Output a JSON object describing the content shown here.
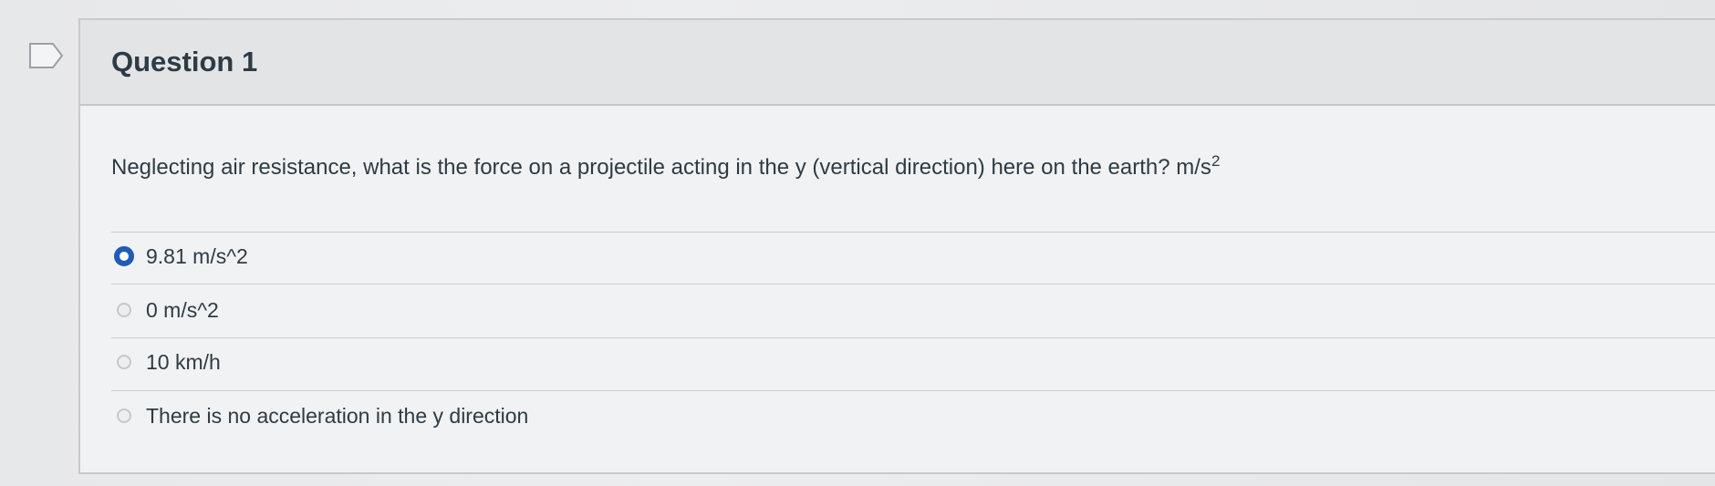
{
  "question": {
    "title": "Question 1",
    "text": "Neglecting air resistance, what is the force on a projectile acting in the y (vertical direction)  here on the earth? m/s",
    "text_superscript": "2"
  },
  "answers": [
    {
      "label": "9.81 m/s^2",
      "selected": true
    },
    {
      "label": "0 m/s^2",
      "selected": false
    },
    {
      "label": "10 km/h",
      "selected": false
    },
    {
      "label": "There is no acceleration in the y direction",
      "selected": false
    }
  ],
  "colors": {
    "selected_radio": "#1f5bb8",
    "text": "#2d3b45"
  },
  "icons": {
    "flag": "flag-question-icon"
  }
}
